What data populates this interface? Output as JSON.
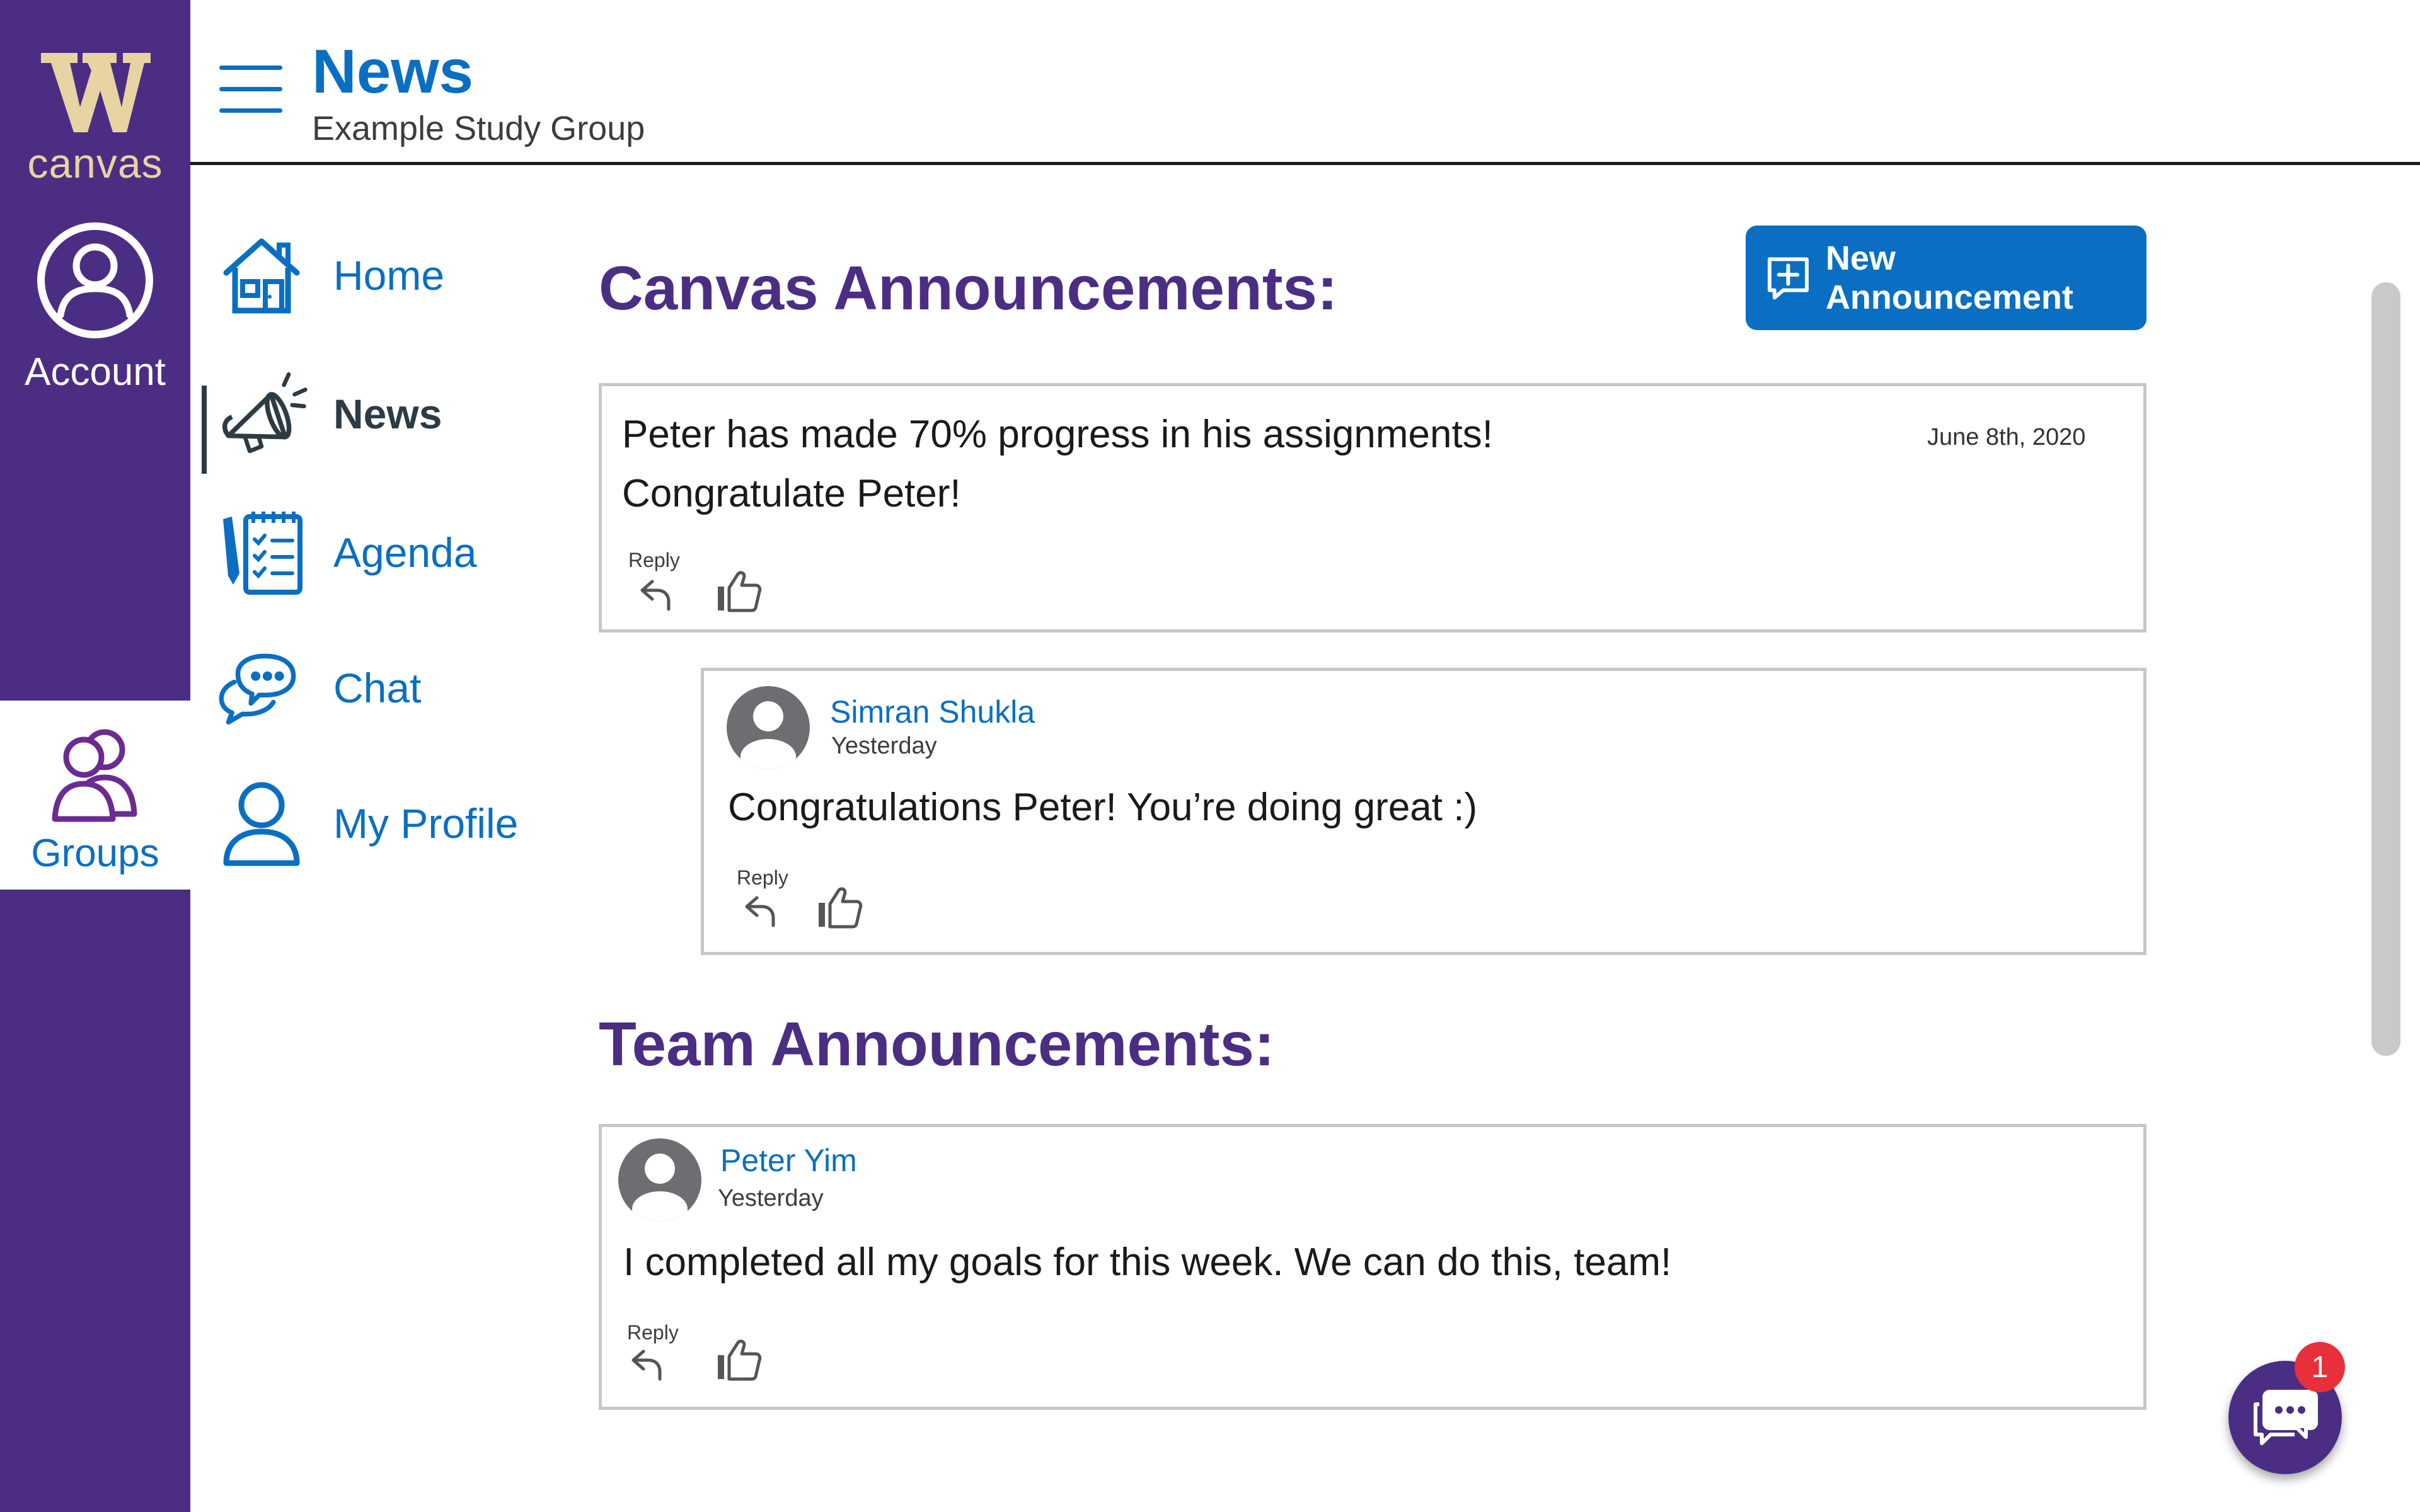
{
  "global_nav": {
    "logo_letter": "W",
    "logo_text": "canvas",
    "account_label": "Account",
    "groups_label": "Groups"
  },
  "header": {
    "title": "News",
    "subtitle": "Example Study Group"
  },
  "course_nav": {
    "items": [
      {
        "label": "Home",
        "icon": "home-icon"
      },
      {
        "label": "News",
        "icon": "megaphone-icon",
        "active": true
      },
      {
        "label": "Agenda",
        "icon": "agenda-icon"
      },
      {
        "label": "Chat",
        "icon": "chat-bubbles-icon"
      },
      {
        "label": "My Profile",
        "icon": "profile-icon"
      }
    ]
  },
  "main": {
    "canvas_section_title": "Canvas Announcements:",
    "new_announcement_label": "New Announcement",
    "team_section_title": "Team Announcements:",
    "announcement": {
      "line1": "Peter has made 70% progress in his assignments!",
      "line2": "Congratulate Peter!",
      "date": "June 8th, 2020",
      "reply_label": "Reply"
    },
    "reply_post": {
      "author": "Simran Shukla",
      "when": "Yesterday",
      "body": "Congratulations Peter! You’re doing great :)",
      "reply_label": "Reply"
    },
    "team_post": {
      "author": "Peter Yim",
      "when": "Yesterday",
      "body": "I completed all my goals for this week. We can do this, team!",
      "reply_label": "Reply"
    }
  },
  "chat_fab": {
    "badge_count": "1"
  },
  "colors": {
    "brand_purple": "#4b2e83",
    "link_blue": "#0a6fc2",
    "gold": "#e8d3a2",
    "badge_red": "#e8303a"
  }
}
